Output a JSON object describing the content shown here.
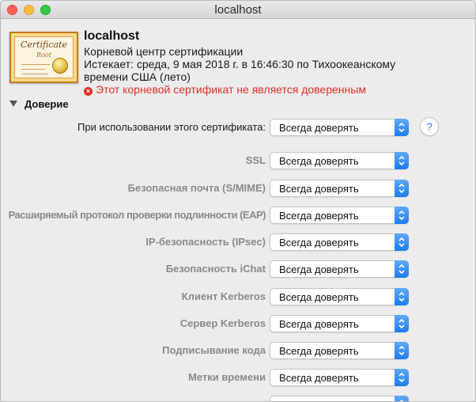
{
  "window": {
    "title": "localhost"
  },
  "certificate": {
    "icon": {
      "heading": "Certificate",
      "subheading": "Root"
    },
    "name": "localhost",
    "kind": "Корневой центр сертификации",
    "expires_line1": "Истекает: среда, 9 мая 2018 г. в 16:46:30 по Тихоокеанскому",
    "expires_line2": "времени США (лето)",
    "warning": "Этот корневой сертификат не является доверенным",
    "warning_icon": "x-circle-icon"
  },
  "trust": {
    "header": "Доверие",
    "help_label": "?",
    "rows": [
      {
        "label": "При использовании этого сертификата:",
        "value": "Всегда доверять"
      },
      {
        "label": "SSL",
        "value": "Всегда доверять"
      },
      {
        "label": "Безопасная почта (S/MIME)",
        "value": "Всегда доверять"
      },
      {
        "label": "Расширяемый протокол проверки подлинности (EAP)",
        "value": "Всегда доверять"
      },
      {
        "label": "IP-безопасность (IPsec)",
        "value": "Всегда доверять"
      },
      {
        "label": "Безопасность iChat",
        "value": "Всегда доверять"
      },
      {
        "label": "Клиент Kerberos",
        "value": "Всегда доверять"
      },
      {
        "label": "Сервер Kerberos",
        "value": "Всегда доверять"
      },
      {
        "label": "Подписывание кода",
        "value": "Всегда доверять"
      },
      {
        "label": "Метки времени",
        "value": "Всегда доверять"
      },
      {
        "label": "",
        "value": ""
      }
    ]
  },
  "colors": {
    "accent": "#1b7cf2",
    "warning": "#e0302a"
  }
}
